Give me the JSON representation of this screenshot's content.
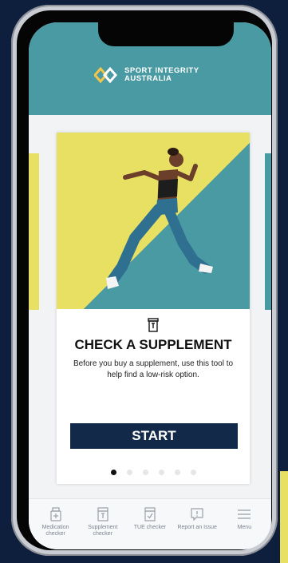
{
  "header": {
    "logo_line1": "SPORT INTEGRITY",
    "logo_line2": "AUSTRALIA"
  },
  "card": {
    "title": "CHECK A SUPPLEMENT",
    "description": "Before you buy a supplement, use this tool to help find a low-risk option.",
    "start_label": "START",
    "icon": "supplement-jar-icon",
    "page_count": 6,
    "active_page": 1
  },
  "bottom_nav": [
    {
      "label": "Medication checker",
      "icon": "medication-icon"
    },
    {
      "label": "Supplement checker",
      "icon": "supplement-icon"
    },
    {
      "label": "TUE checker",
      "icon": "tue-checkbox-icon"
    },
    {
      "label": "Report an Issue",
      "icon": "report-issue-icon"
    },
    {
      "label": "Menu",
      "icon": "hamburger-menu-icon"
    }
  ],
  "colors": {
    "teal": "#4a9aa3",
    "yellow": "#e8e063",
    "navy": "#12294a",
    "background": "#0d1f3c"
  }
}
